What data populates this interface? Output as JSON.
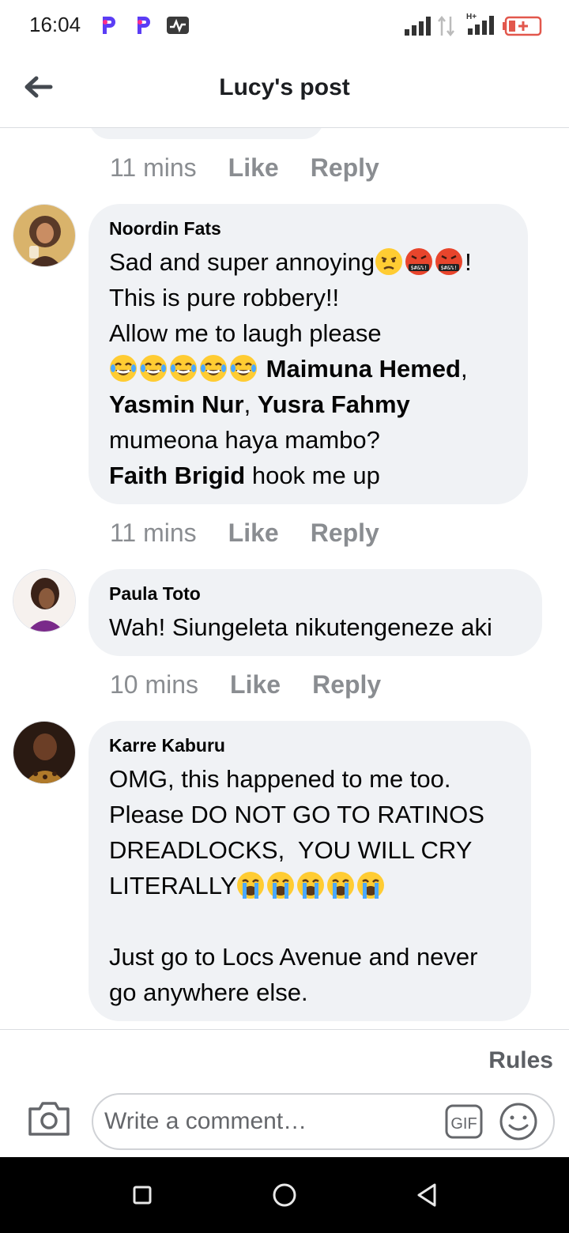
{
  "status": {
    "time": "16:04",
    "icons": [
      "p-app-icon",
      "p-app-icon",
      "activity-icon",
      "signal-icon",
      "data-arrows-icon",
      "hplus-signal-icon",
      "battery-low-icon"
    ]
  },
  "header": {
    "title": "Lucy's post"
  },
  "top_meta": {
    "time": "11 mins",
    "like": "Like",
    "reply": "Reply"
  },
  "comments": [
    {
      "author": "Noordin Fats",
      "line1": "Sad and super annoying",
      "line1_end": "!",
      "line2": "This is pure robbery!!",
      "line3": "Allow me to laugh please",
      "tag1": "Maimuna Hemed",
      "sep1": ",",
      "tag2": "Yasmin Nur",
      "sep2": ", ",
      "tag3": "Yusra Fahmy",
      "line6": "mumeona haya mambo?",
      "tag4": "Faith Brigid",
      "line7_rest": " hook me up",
      "emojis_line1": [
        "unamused-face-icon",
        "cursing-face-icon",
        "cursing-face-icon"
      ],
      "emojis_line4": [
        "tears-of-joy-icon",
        "tears-of-joy-icon",
        "tears-of-joy-icon",
        "tears-of-joy-icon",
        "tears-of-joy-icon"
      ],
      "meta": {
        "time": "11 mins",
        "like": "Like",
        "reply": "Reply"
      }
    },
    {
      "author": "Paula Toto",
      "text": "Wah! Siungeleta nikutengeneze aki",
      "meta": {
        "time": "10 mins",
        "like": "Like",
        "reply": "Reply"
      }
    },
    {
      "author": "Karre Kaburu",
      "line1": "OMG, this happened to me too.",
      "line2": "Please DO NOT GO TO RATINOS",
      "line3": "DREADLOCKS,  YOU WILL CRY",
      "line4": "LITERALLY",
      "emojis_line4": [
        "loudly-crying-icon",
        "loudly-crying-icon",
        "loudly-crying-icon",
        "loudly-crying-icon",
        "loudly-crying-icon"
      ],
      "line6": "Just go to Locs Avenue and never",
      "line7": "go anywhere else."
    }
  ],
  "composer": {
    "rules": "Rules",
    "placeholder": "Write a comment…",
    "gif_label": "GIF"
  },
  "colors": {
    "bubble": "#f0f2f5",
    "meta_text": "#8a8d91",
    "divider": "#dadde1"
  }
}
